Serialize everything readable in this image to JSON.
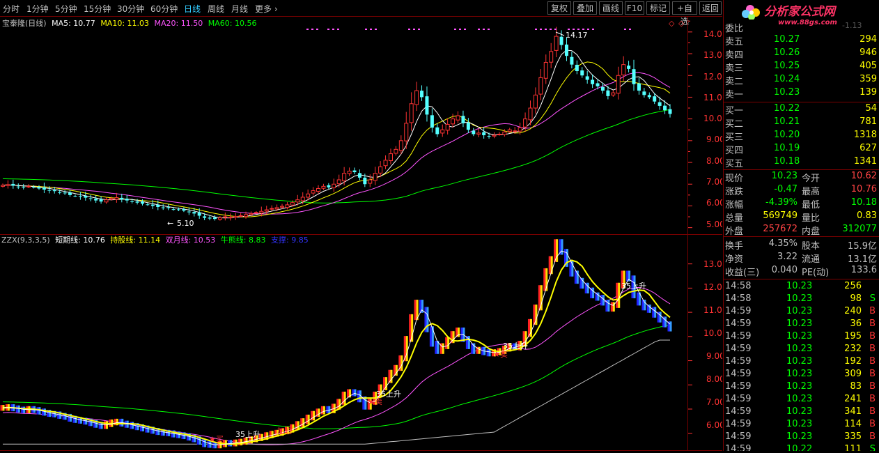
{
  "toolbar": {
    "tabs": [
      {
        "label": "分时",
        "active": false
      },
      {
        "label": "1分钟",
        "active": false
      },
      {
        "label": "5分钟",
        "active": false
      },
      {
        "label": "15分钟",
        "active": false
      },
      {
        "label": "30分钟",
        "active": false
      },
      {
        "label": "60分钟",
        "active": false
      },
      {
        "label": "日线",
        "active": true
      },
      {
        "label": "周线",
        "active": false
      },
      {
        "label": "月线",
        "active": false
      },
      {
        "label": "更多 ›",
        "active": false
      }
    ],
    "buttons": [
      "复权",
      "叠加",
      "画线",
      "F10",
      "标记",
      "+自选",
      "返回"
    ]
  },
  "main_chart": {
    "legend": [
      {
        "text": "宝泰隆(日线)",
        "color": "#c0c0c0"
      },
      {
        "text": "MA5: 10.77",
        "color": "#ffffff"
      },
      {
        "text": "MA10: 11.03",
        "color": "#ffff00"
      },
      {
        "text": "MA20: 11.50",
        "color": "#ff55ff"
      },
      {
        "text": "MA60: 10.56",
        "color": "#00ff00"
      }
    ],
    "price_labels": [
      "14.00",
      "13.00",
      "12.00",
      "11.00",
      "10.00",
      "9.00",
      "8.00",
      "7.00",
      "6.00",
      "5.00"
    ],
    "high_marker": "14.17",
    "low_marker": "5.10",
    "corner_marks": [
      "◇",
      "◇"
    ]
  },
  "indicator": {
    "legend": [
      {
        "text": "ZZX(9,3,3,5)",
        "color": "#c0c0c0"
      },
      {
        "text": "短期线: 10.76",
        "color": "#ffffff"
      },
      {
        "text": "持股线: 11.14",
        "color": "#ffff00"
      },
      {
        "text": "双月线: 10.53",
        "color": "#ff55ff"
      },
      {
        "text": "牛熊线: 8.83",
        "color": "#00ff00"
      },
      {
        "text": "支撑: 9.85",
        "color": "#3333ff"
      }
    ],
    "price_labels": [
      "13.00",
      "12.00",
      "11.00",
      "10.00",
      "9.00",
      "8.00",
      "7.00",
      "6.00"
    ],
    "annotations": [
      {
        "text": "35上升",
        "color": "#ffffff"
      },
      {
        "text": "35上升",
        "color": "#ffffff"
      },
      {
        "text": "35上升",
        "color": "#ffffff"
      },
      {
        "text": "★卖",
        "color": "#ff3333"
      },
      {
        "text": "★卖",
        "color": "#ff3333"
      },
      {
        "text": "加仓",
        "color": "#ff3333"
      },
      {
        "text": "★买",
        "color": "#ff3333"
      },
      {
        "text": "35上升",
        "color": "#ffffff"
      }
    ]
  },
  "quote_panel": {
    "logo_text": "分析家公式网",
    "logo_url": "www.88gs.com",
    "wei": {
      "label": "委比",
      "value": "",
      "cut_text": "-1.13"
    },
    "sell": [
      {
        "label": "卖五",
        "price": "10.27",
        "vol": "294"
      },
      {
        "label": "卖四",
        "price": "10.26",
        "vol": "946"
      },
      {
        "label": "卖三",
        "price": "10.25",
        "vol": "405"
      },
      {
        "label": "卖二",
        "price": "10.24",
        "vol": "359"
      },
      {
        "label": "卖一",
        "price": "10.23",
        "vol": "139"
      }
    ],
    "buy": [
      {
        "label": "买一",
        "price": "10.22",
        "vol": "54"
      },
      {
        "label": "买二",
        "price": "10.21",
        "vol": "781"
      },
      {
        "label": "买三",
        "price": "10.20",
        "vol": "1318"
      },
      {
        "label": "买四",
        "price": "10.19",
        "vol": "627"
      },
      {
        "label": "买五",
        "price": "10.18",
        "vol": "1341"
      }
    ],
    "stats": [
      {
        "l1": "现价",
        "v1": "10.23",
        "c1": "#00ff00",
        "l2": "今开",
        "v2": "10.62",
        "c2": "#ff4444"
      },
      {
        "l1": "涨跌",
        "v1": "-0.47",
        "c1": "#00ff00",
        "l2": "最高",
        "v2": "10.76",
        "c2": "#ff4444"
      },
      {
        "l1": "涨幅",
        "v1": "-4.39%",
        "c1": "#00ff00",
        "l2": "最低",
        "v2": "10.18",
        "c2": "#00ff00"
      },
      {
        "l1": "总量",
        "v1": "569749",
        "c1": "#ffff00",
        "l2": "量比",
        "v2": "0.83",
        "c2": "#ffff00"
      },
      {
        "l1": "外盘",
        "v1": "257672",
        "c1": "#ff4444",
        "l2": "内盘",
        "v2": "312077",
        "c2": "#00ff00"
      }
    ],
    "fund": [
      {
        "l1": "换手",
        "v1": "4.35%",
        "l2": "股本",
        "v2": "15.9亿"
      },
      {
        "l1": "净资",
        "v1": "3.22",
        "l2": "流通",
        "v2": "13.1亿"
      },
      {
        "l1": "收益(三)",
        "v1": "0.040",
        "l2": "PE(动)",
        "v2": "133.6"
      }
    ],
    "ticks": [
      {
        "time": "14:58",
        "price": "10.23",
        "vol": "256",
        "side": "",
        "pc": "#00ff00"
      },
      {
        "time": "14:58",
        "price": "10.23",
        "vol": "98",
        "side": "S",
        "pc": "#00ff00"
      },
      {
        "time": "14:59",
        "price": "10.23",
        "vol": "240",
        "side": "B",
        "pc": "#00ff00"
      },
      {
        "time": "14:59",
        "price": "10.23",
        "vol": "36",
        "side": "B",
        "pc": "#00ff00"
      },
      {
        "time": "14:59",
        "price": "10.23",
        "vol": "195",
        "side": "B",
        "pc": "#00ff00"
      },
      {
        "time": "14:59",
        "price": "10.23",
        "vol": "232",
        "side": "B",
        "pc": "#00ff00"
      },
      {
        "time": "14:59",
        "price": "10.23",
        "vol": "192",
        "side": "B",
        "pc": "#00ff00"
      },
      {
        "time": "14:59",
        "price": "10.23",
        "vol": "309",
        "side": "B",
        "pc": "#00ff00"
      },
      {
        "time": "14:59",
        "price": "10.23",
        "vol": "83",
        "side": "B",
        "pc": "#00ff00"
      },
      {
        "time": "14:59",
        "price": "10.23",
        "vol": "241",
        "side": "B",
        "pc": "#00ff00"
      },
      {
        "time": "14:59",
        "price": "10.23",
        "vol": "341",
        "side": "B",
        "pc": "#00ff00"
      },
      {
        "time": "14:59",
        "price": "10.23",
        "vol": "114",
        "side": "B",
        "pc": "#00ff00"
      },
      {
        "time": "14:59",
        "price": "10.23",
        "vol": "335",
        "side": "B",
        "pc": "#00ff00"
      },
      {
        "time": "14:59",
        "price": "10.22",
        "vol": "111",
        "side": "S",
        "pc": "#00ff00"
      }
    ]
  },
  "chart_data": {
    "type": "candlestick",
    "main": {
      "y_range": [
        4.7,
        14.7
      ],
      "highest": 14.17,
      "lowest": 5.1,
      "close_series": [
        6.95,
        6.98,
        6.93,
        6.88,
        6.85,
        6.9,
        6.86,
        6.8,
        6.75,
        6.7,
        6.68,
        6.62,
        6.58,
        6.5,
        6.45,
        6.42,
        6.38,
        6.32,
        6.25,
        6.2,
        6.28,
        6.35,
        6.38,
        6.3,
        6.25,
        6.2,
        6.15,
        6.1,
        6.05,
        6.0,
        5.95,
        5.92,
        5.9,
        5.85,
        5.82,
        5.78,
        5.72,
        5.65,
        5.55,
        5.45,
        5.42,
        5.4,
        5.45,
        5.5,
        5.48,
        5.52,
        5.55,
        5.6,
        5.65,
        5.7,
        5.75,
        5.82,
        5.88,
        5.92,
        5.98,
        6.05,
        6.15,
        6.28,
        6.4,
        6.55,
        6.7,
        6.8,
        6.9,
        6.85,
        7.0,
        7.2,
        7.5,
        7.6,
        7.55,
        7.3,
        7.0,
        7.2,
        7.5,
        7.8,
        8.1,
        8.4,
        8.6,
        9.0,
        9.8,
        10.7,
        11.3,
        11.0,
        10.2,
        9.6,
        9.3,
        9.5,
        9.75,
        10.0,
        10.15,
        9.8,
        9.5,
        9.3,
        9.35,
        9.25,
        9.2,
        9.25,
        9.3,
        9.4,
        9.5,
        9.45,
        9.6,
        10.0,
        10.5,
        11.1,
        11.9,
        12.6,
        13.1,
        13.8,
        13.4,
        12.9,
        12.5,
        12.2,
        12.0,
        11.8,
        11.6,
        11.5,
        11.3,
        11.05,
        11.2,
        12.0,
        12.5,
        12.3,
        11.6,
        11.3,
        11.1,
        11.0,
        10.8,
        10.6,
        10.4,
        10.23
      ],
      "ma_names": [
        "MA5",
        "MA10",
        "MA20",
        "MA60"
      ],
      "ma_values": [
        10.77,
        11.03,
        11.5,
        10.56
      ]
    },
    "indicator": {
      "name": "ZZX(9,3,3,5)",
      "y_range": [
        5.3,
        14.2
      ],
      "series": [
        {
          "name": "短期线",
          "last": 10.76
        },
        {
          "name": "持股线",
          "last": 11.14
        },
        {
          "name": "双月线",
          "last": 10.53
        },
        {
          "name": "牛熊线",
          "last": 8.83
        },
        {
          "name": "支撑",
          "last": 9.85
        }
      ]
    }
  }
}
